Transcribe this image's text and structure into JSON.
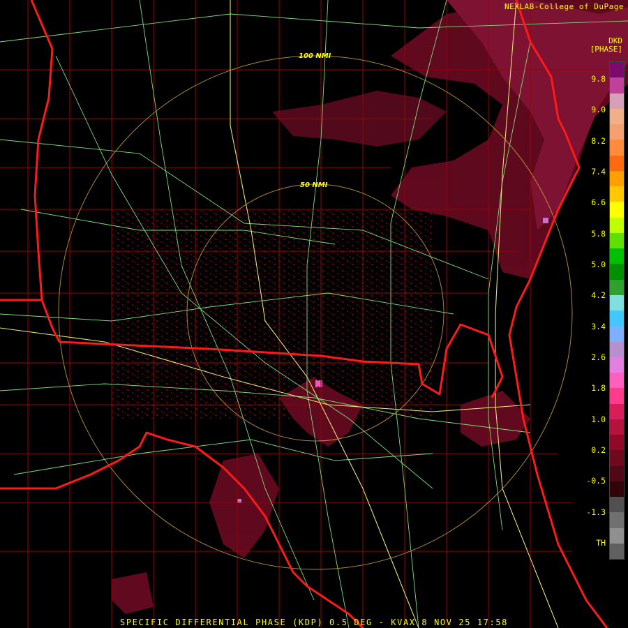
{
  "header": {
    "credit": "NEXLAB-College of DuPage",
    "product_code": "DKD",
    "product_unit": "[PHASE]"
  },
  "footer": {
    "caption": "SPECIFIC DIFFERENTIAL PHASE (KDP) 0.5 DEG - KVAX 8 NOV 25 17:58"
  },
  "map": {
    "range_rings": [
      {
        "label": "100 NMI"
      },
      {
        "label": "50 NMI"
      }
    ],
    "colors": {
      "state_border": "#ff1a1a",
      "county_border": "#a00000",
      "highway": "#e6e67a",
      "road": "#7ce07c",
      "ring": "#c8a040",
      "echo_light": "#6a0a22",
      "echo_medium": "#8c1438",
      "echo_pink": "#ff66cc"
    }
  },
  "legend": {
    "labels": [
      "9.8",
      "9.0",
      "8.2",
      "7.4",
      "6.6",
      "5.8",
      "5.0",
      "4.2",
      "3.4",
      "2.6",
      "1.8",
      "1.0",
      "0.2",
      "-0.5",
      "-1.3",
      "TH"
    ],
    "colors": [
      "#7a0a6e",
      "#c0409a",
      "#d8a0b8",
      "#f0b088",
      "#f5a070",
      "#ff8c3c",
      "#ff6a10",
      "#ff9f00",
      "#ffc800",
      "#ffff00",
      "#c0ff00",
      "#60e000",
      "#00c000",
      "#009000",
      "#30a030",
      "#80e0e0",
      "#40c8ff",
      "#7fb0ff",
      "#b890d0",
      "#e080e0",
      "#ff60c0",
      "#ff3c8c",
      "#d81e5a",
      "#b4143c",
      "#900a28",
      "#6e0a1c",
      "#500814",
      "#300408",
      "#505050",
      "#707070",
      "#909090",
      "#606060"
    ]
  }
}
